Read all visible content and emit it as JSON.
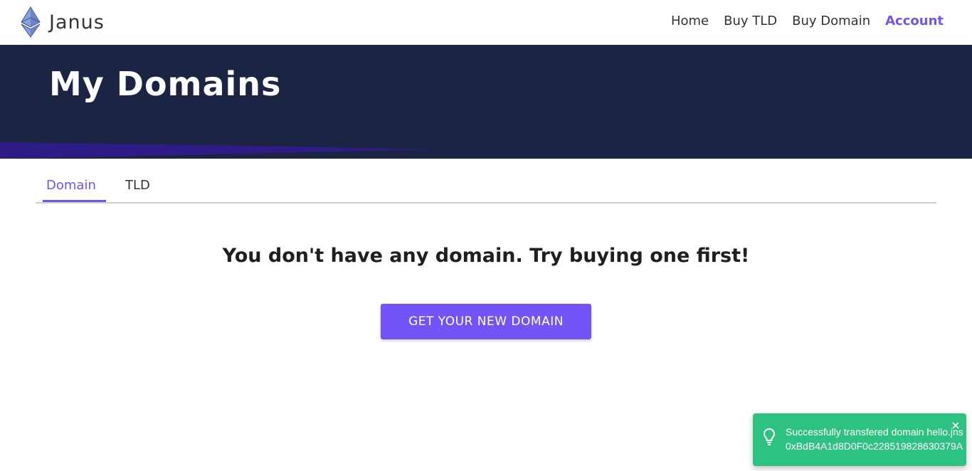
{
  "brand": {
    "name": "Janus",
    "logo_icon": "ethereum-diamond-icon"
  },
  "nav": {
    "items": [
      {
        "label": "Home",
        "active": false
      },
      {
        "label": "Buy TLD",
        "active": false
      },
      {
        "label": "Buy Domain",
        "active": false
      },
      {
        "label": "Account",
        "active": true
      }
    ]
  },
  "hero": {
    "title": "My Domains"
  },
  "tabs": [
    {
      "label": "Domain",
      "active": true
    },
    {
      "label": "TLD",
      "active": false
    }
  ],
  "empty_state": {
    "message": "You don't have any domain. Try buying one first!",
    "button_label": "GET YOUR NEW DOMAIN"
  },
  "toast": {
    "line1": "Successfully transfered domain hello.jns",
    "line2": "0xBdB4A1d8D0F0c228519828630379A",
    "icon": "lightbulb-icon",
    "close_icon": "close-icon"
  },
  "colors": {
    "accent": "#7353f5",
    "hero_background": "#1b2443",
    "toast_background": "#2ec282"
  }
}
